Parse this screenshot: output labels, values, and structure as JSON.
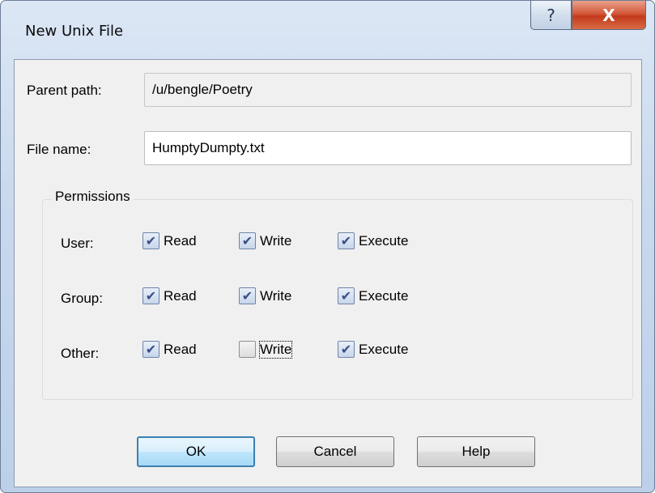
{
  "window": {
    "title": "New Unix File",
    "help_icon": "?",
    "close_icon": "X"
  },
  "parent_path": {
    "label": "Parent path:",
    "value": "/u/bengle/Poetry"
  },
  "file_name": {
    "label": "File name:",
    "value": "HumptyDumpty.txt"
  },
  "permissions": {
    "legend": "Permissions",
    "rows": [
      {
        "label": "User:",
        "read": {
          "label": "Read",
          "checked": true
        },
        "write": {
          "label": "Write",
          "checked": true
        },
        "execute": {
          "label": "Execute",
          "checked": true
        }
      },
      {
        "label": "Group:",
        "read": {
          "label": "Read",
          "checked": true
        },
        "write": {
          "label": "Write",
          "checked": true
        },
        "execute": {
          "label": "Execute",
          "checked": true
        }
      },
      {
        "label": "Other:",
        "read": {
          "label": "Read",
          "checked": true
        },
        "write": {
          "label": "Write",
          "checked": false
        },
        "execute": {
          "label": "Execute",
          "checked": true
        }
      }
    ]
  },
  "buttons": {
    "ok": "OK",
    "cancel": "Cancel",
    "help": "Help"
  },
  "colors": {
    "title_bar": "#c9d9ee",
    "close_button": "#c23a1c",
    "dialog_background": "#f0f0f0",
    "default_button_border": "#3c7fb1",
    "check_mark": "#3a4f86"
  }
}
